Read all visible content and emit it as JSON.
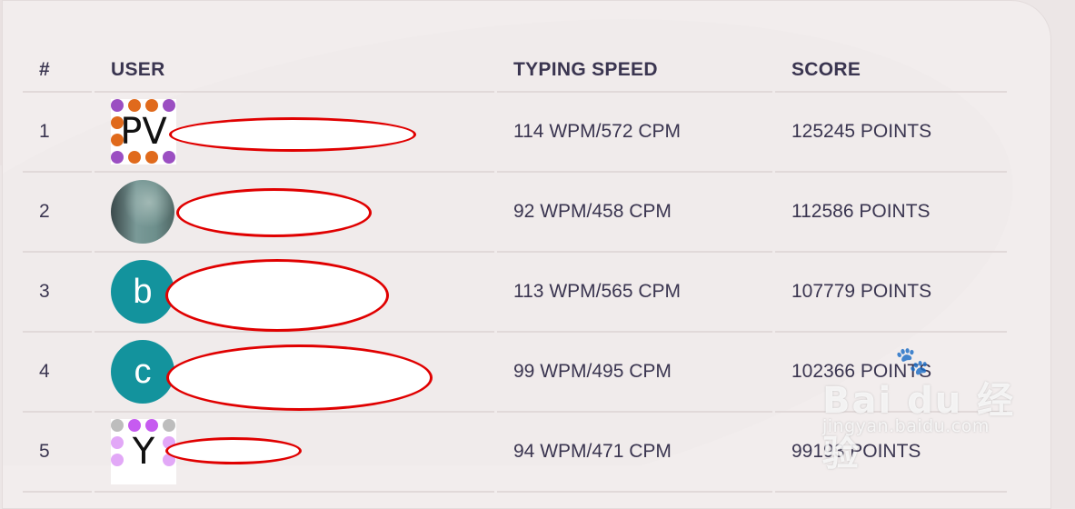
{
  "leaderboard": {
    "columns": {
      "rank": "#",
      "user": "USER",
      "speed": "TYPING SPEED",
      "score": "SCORE"
    },
    "rows": [
      {
        "rank": "1",
        "avatar_type": "identicon",
        "avatar_text": "PV",
        "speed": "114 WPM/572 CPM",
        "score": "125245 POINTS"
      },
      {
        "rank": "2",
        "avatar_type": "photo",
        "avatar_text": "",
        "speed": "92 WPM/458 CPM",
        "score": "112586 POINTS"
      },
      {
        "rank": "3",
        "avatar_type": "letter",
        "avatar_text": "b",
        "speed": "113 WPM/565 CPM",
        "score": "107779 POINTS"
      },
      {
        "rank": "4",
        "avatar_type": "letter",
        "avatar_text": "c",
        "speed": "99 WPM/495 CPM",
        "score": "102366 POINTS"
      },
      {
        "rank": "5",
        "avatar_type": "identicon",
        "avatar_text": "Y",
        "speed": "94 WPM/471 CPM",
        "score": "99193 POINTS"
      }
    ]
  },
  "watermark": {
    "logo": "Bai du 经验",
    "url": "jingyan.baidu.com"
  },
  "colors": {
    "letter_avatar": "#13939d",
    "redaction_outline": "#e00000",
    "text": "#3a3550"
  }
}
